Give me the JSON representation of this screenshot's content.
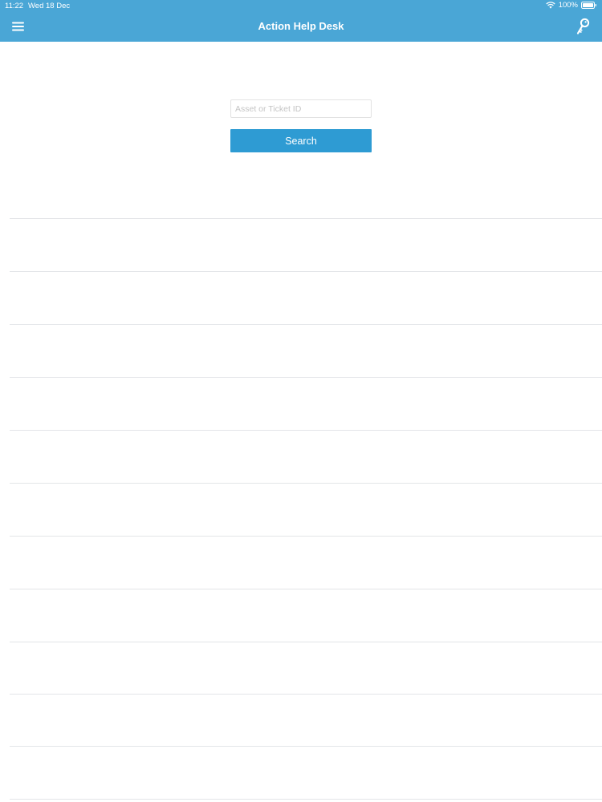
{
  "status_bar": {
    "time": "11:22",
    "date": "Wed 18 Dec",
    "battery": "100%"
  },
  "nav": {
    "title": "Action Help Desk",
    "left_icon": "hamburger-menu-icon",
    "right_icon": "key-icon"
  },
  "search": {
    "placeholder": "Asset or Ticket ID",
    "value": "",
    "button_label": "Search"
  },
  "colors": {
    "header": "#4aa6d6",
    "button": "#2e9bd3",
    "divider": "#e3e5e8"
  },
  "results": {
    "row_count": 11
  }
}
